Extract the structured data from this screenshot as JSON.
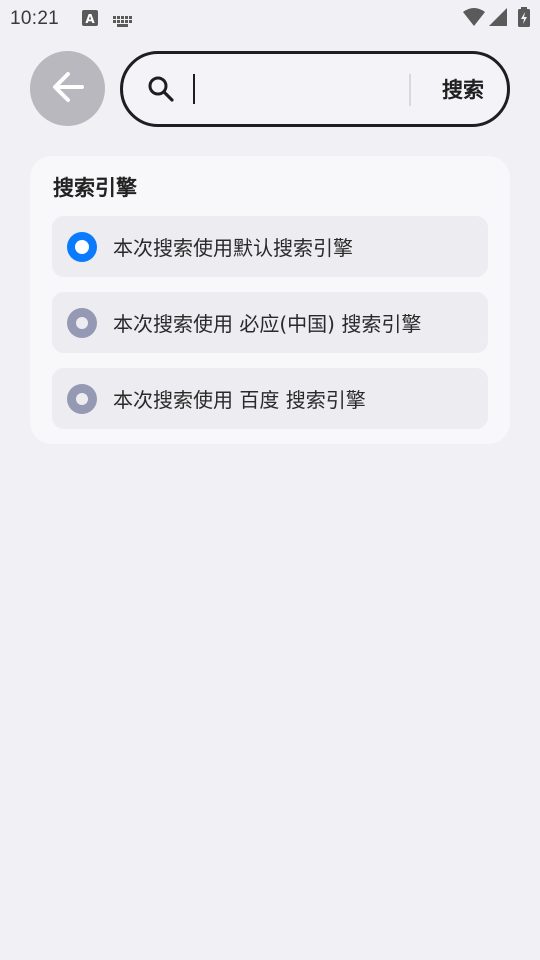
{
  "status_bar": {
    "time": "10:21",
    "icons": [
      "text-input-notification-icon",
      "keyboard-icon",
      "wifi-icon",
      "cellular-signal-icon",
      "battery-icon"
    ]
  },
  "search": {
    "back_icon": "arrow-left-icon",
    "search_icon": "search-icon",
    "query": "",
    "button_label": "搜索"
  },
  "engine_card": {
    "title": "搜索引擎",
    "options": [
      {
        "label": "本次搜索使用默认搜索引擎",
        "selected": true
      },
      {
        "label": "本次搜索使用 必应(中国) 搜索引擎",
        "selected": false
      },
      {
        "label": "本次搜索使用 百度 搜索引擎",
        "selected": false
      }
    ]
  },
  "colors": {
    "background": "#f1f0f5",
    "accent": "#0a7aff",
    "radio_unselected": "#9599b4"
  }
}
